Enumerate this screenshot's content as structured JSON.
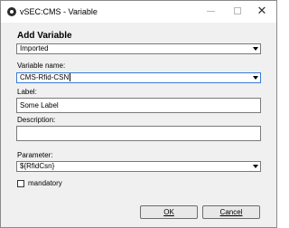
{
  "window": {
    "title": "vSEC:CMS - Variable",
    "close_glyph": "✕"
  },
  "form": {
    "heading": "Add Variable",
    "type_select": {
      "value": "Imported"
    },
    "variable_name": {
      "label": "Variable name:",
      "value": "CMS-Rfid-CSN"
    },
    "label_field": {
      "label": "Label:",
      "value": "Some Label"
    },
    "description": {
      "label": "Description:",
      "value": ""
    },
    "parameter": {
      "label": "Parameter:",
      "value": "${RfidCsn}"
    },
    "mandatory": {
      "label": "mandatory",
      "checked": false
    }
  },
  "buttons": {
    "ok_label": "OK",
    "cancel_label": "Cancel"
  },
  "icons": {
    "app": "app-icon",
    "minimize": "minimize-icon",
    "maximize": "maximize-icon",
    "close": "close-icon",
    "dropdown": "chevron-down-icon"
  },
  "colors": {
    "window_bg": "#f0f0f0",
    "titlebar_bg": "#ffffff",
    "focus_border": "#3a7bd5"
  }
}
